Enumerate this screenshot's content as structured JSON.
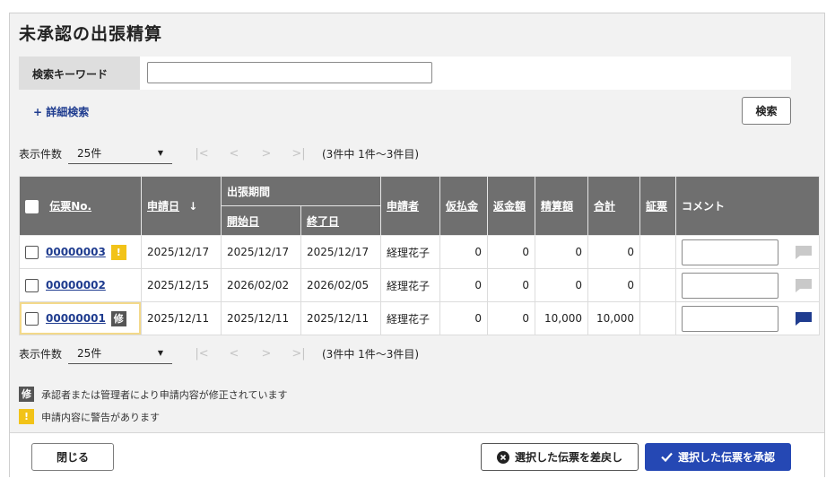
{
  "page": {
    "title": "未承認の出張精算",
    "search": {
      "keyword_label": "検索キーワード",
      "keyword_value": "",
      "detail_link": "+ 詳細検索",
      "search_button": "検索"
    },
    "pager": {
      "label": "表示件数",
      "per_page": "25件",
      "range": "(3件中 1件〜3件目)"
    },
    "table": {
      "headers": {
        "voucher_no": "伝票No.",
        "application_date": "申請日",
        "trip_period": "出張期間",
        "start_date": "開始日",
        "end_date": "終了日",
        "applicant": "申請者",
        "advance": "仮払金",
        "refund": "返金額",
        "settlement": "精算額",
        "total": "合計",
        "receipt": "証票",
        "comment": "コメント"
      },
      "rows": [
        {
          "voucher_no": "00000003",
          "badge": "!",
          "application_date": "2025/12/17",
          "start_date": "2025/12/17",
          "end_date": "2025/12/17",
          "applicant": "経理花子",
          "advance": "0",
          "refund": "0",
          "settlement": "0",
          "total": "0",
          "receipt": "",
          "comment": "",
          "chat_color": "#c9c9c9"
        },
        {
          "voucher_no": "00000002",
          "badge": "",
          "application_date": "2025/12/15",
          "start_date": "2026/02/02",
          "end_date": "2026/02/05",
          "applicant": "経理花子",
          "advance": "0",
          "refund": "0",
          "settlement": "0",
          "total": "0",
          "receipt": "",
          "comment": "",
          "chat_color": "#c9c9c9"
        },
        {
          "voucher_no": "00000001",
          "badge": "修",
          "application_date": "2025/12/11",
          "start_date": "2025/12/11",
          "end_date": "2025/12/11",
          "applicant": "経理花子",
          "advance": "0",
          "refund": "0",
          "settlement": "10,000",
          "total": "10,000",
          "receipt": "",
          "comment": "",
          "chat_color": "#1f3c8f"
        }
      ]
    },
    "legend": {
      "modified_badge": "修",
      "modified_text": "承認者または管理者により申請内容が修正されています",
      "warning_badge": "!",
      "warning_text": "申請内容に警告があります"
    },
    "footer": {
      "close": "閉じる",
      "return": "選択した伝票を差戻し",
      "approve": "選択した伝票を承認"
    },
    "colors": {
      "accent": "#2548b4",
      "link": "#1f3c8f",
      "header_bg": "#6f6f6f",
      "warning": "#f2c318"
    }
  }
}
